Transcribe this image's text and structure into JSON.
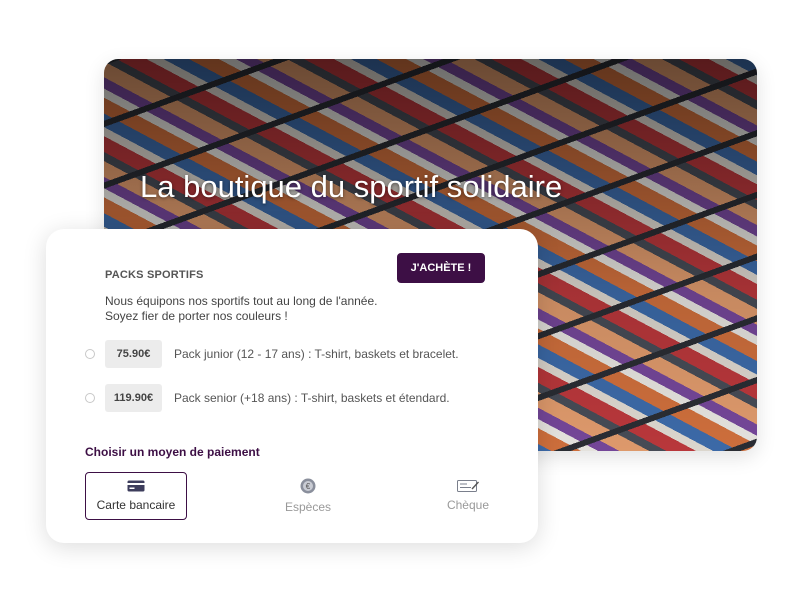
{
  "hero": {
    "title": "La boutique du sportif solidaire",
    "image": "shoe-store-shelves-photo"
  },
  "packs": {
    "title": "PACKS SPORTIFS",
    "buy_label": "J'ACHÈTE !",
    "description_line1": "Nous équipons nos sportifs tout au long de l'année.",
    "description_line2": "Soyez fier de porter nos couleurs !",
    "options": [
      {
        "price": "75.90€",
        "label": "Pack junior (12 - 17 ans) : T-shirt, baskets et bracelet."
      },
      {
        "price": "119.90€",
        "label": "Pack senior (+18 ans) : T-shirt, baskets et étendard."
      }
    ]
  },
  "payment": {
    "title": "Choisir un moyen de paiement",
    "methods": [
      {
        "label": "Carte bancaire",
        "icon": "credit-card-icon",
        "selected": true
      },
      {
        "label": "Espèces",
        "icon": "coin-icon",
        "selected": false
      },
      {
        "label": "Chèque",
        "icon": "cheque-icon",
        "selected": false
      }
    ]
  },
  "colors": {
    "brand": "#3d0f45",
    "muted": "#999999",
    "price_bg": "#ececec"
  }
}
